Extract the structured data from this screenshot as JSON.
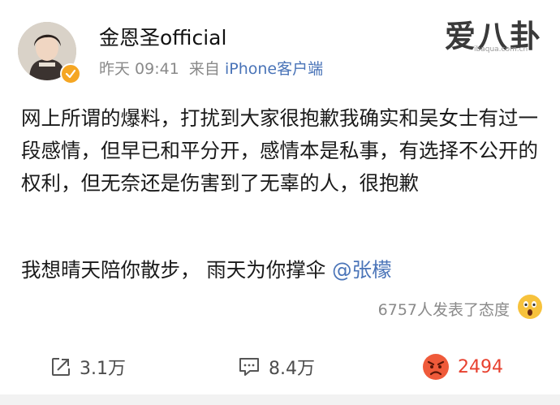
{
  "post": {
    "author": {
      "name": "金恩圣official",
      "avatar_icon": "profile-avatar",
      "verified_icon": "verified-badge-icon"
    },
    "meta": {
      "time": "昨天 09:41",
      "source_prefix": "来自",
      "source": "iPhone客户端"
    },
    "watermark": {
      "text": "爱八卦",
      "url": "ibaqua.com.cn"
    },
    "body": "网上所谓的爆料，打扰到大家很抱歉我确实和吴女士有过一段感情，但早已和平分开，感情本是私事，有选择不公开的权利，但无奈还是伤害到了无辜的人，很抱歉",
    "body2_text": "我想晴天陪你散步， 雨天为你撑伞 ",
    "mention": "@张檬",
    "reaction_summary": "6757人发表了态度",
    "reaction_icon": "shocked-face-icon"
  },
  "actions": {
    "repost": {
      "icon": "repost-icon",
      "count": "3.1万"
    },
    "comment": {
      "icon": "comment-icon",
      "count": "8.4万"
    },
    "like": {
      "icon": "angry-face-icon",
      "count": "2494"
    }
  },
  "colors": {
    "link": "#4a74b8",
    "meta": "#8a8a8a",
    "like_count": "#e8412f",
    "verified": "#f5a623"
  }
}
